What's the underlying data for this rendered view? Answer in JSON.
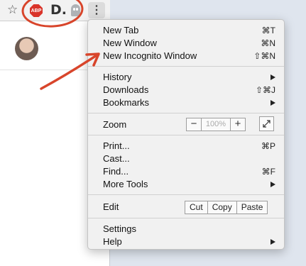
{
  "toolbar": {
    "star_icon": "star-icon",
    "abp_label": "ABP",
    "d_label": "D.",
    "ghost_icon": "ghost-icon",
    "menu_glyph": "⋮"
  },
  "menu": {
    "items": [
      {
        "label": "New Tab",
        "shortcut": "⌘T"
      },
      {
        "label": "New Window",
        "shortcut": "⌘N"
      },
      {
        "label": "New Incognito Window",
        "shortcut": "⇧⌘N"
      },
      {
        "label": "History"
      },
      {
        "label": "Downloads",
        "shortcut": "⇧⌘J"
      },
      {
        "label": "Bookmarks"
      },
      {
        "label": "Zoom"
      },
      {
        "label": "Print...",
        "shortcut": "⌘P"
      },
      {
        "label": "Cast..."
      },
      {
        "label": "Find...",
        "shortcut": "⌘F"
      },
      {
        "label": "More Tools"
      },
      {
        "label": "Edit"
      },
      {
        "label": "Settings"
      },
      {
        "label": "Help"
      }
    ],
    "zoom": {
      "minus": "−",
      "value": "100%",
      "plus": "+"
    },
    "edit": {
      "cut": "Cut",
      "copy": "Copy",
      "paste": "Paste"
    }
  },
  "colors": {
    "annotation": "#d8452b",
    "abp_red": "#d9342a",
    "menu_bg": "#f1f1f1"
  }
}
